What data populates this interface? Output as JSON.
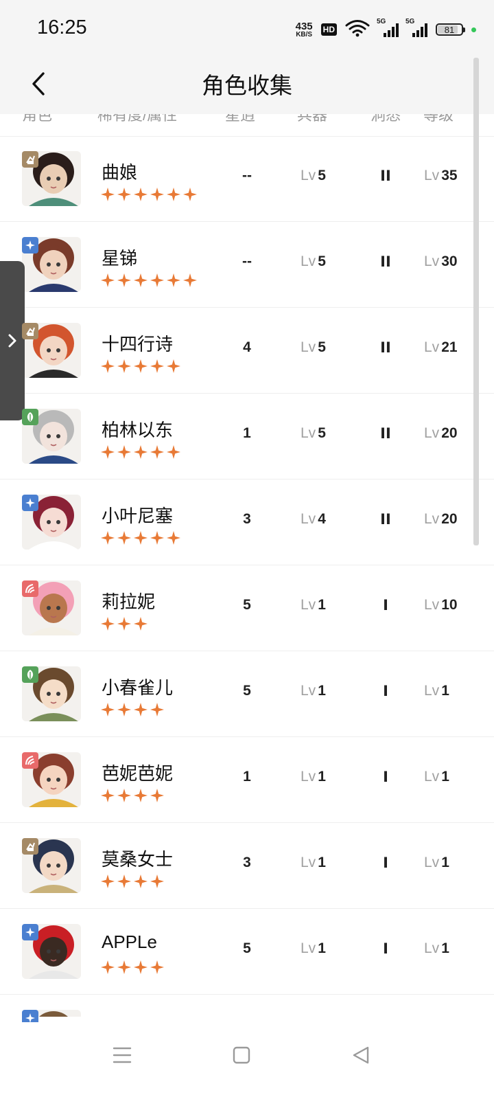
{
  "status_bar": {
    "time": "16:25",
    "net_speed_value": "435",
    "net_speed_unit": "KB/S",
    "hd_badge": "HD",
    "signal_1_label": "5G",
    "signal_2_label": "5G",
    "battery": "81",
    "icons": [
      "wifi-icon",
      "signal-icon",
      "battery-icon"
    ]
  },
  "header": {
    "title": "角色收集",
    "back_icon": "chevron-left-icon"
  },
  "columns": {
    "role": "角色",
    "rarity_attr": "稀有度/属性",
    "stars": "星逍",
    "weapon": "兵器",
    "mind": "洞悉",
    "level": "等级"
  },
  "level_prefix": "Lv",
  "element_colors": {
    "beast": "#a58a66",
    "star": "#4a7fd0",
    "plant": "#55a25a",
    "intellect": "#e86a6a"
  },
  "star_color": "#e87a36",
  "characters": [
    {
      "name": "曲娘",
      "rarity": 6,
      "element": "beast",
      "stars_val": "--",
      "weapon": "5",
      "mind": "II",
      "level": "35"
    },
    {
      "name": "星锑",
      "rarity": 6,
      "element": "star",
      "stars_val": "--",
      "weapon": "5",
      "mind": "II",
      "level": "30"
    },
    {
      "name": "十四行诗",
      "rarity": 5,
      "element": "beast",
      "stars_val": "4",
      "weapon": "5",
      "mind": "II",
      "level": "21"
    },
    {
      "name": "柏林以东",
      "rarity": 5,
      "element": "plant",
      "stars_val": "1",
      "weapon": "5",
      "mind": "II",
      "level": "20"
    },
    {
      "name": "小叶尼塞",
      "rarity": 5,
      "element": "star",
      "stars_val": "3",
      "weapon": "4",
      "mind": "II",
      "level": "20"
    },
    {
      "name": "莉拉妮",
      "rarity": 3,
      "element": "intellect",
      "stars_val": "5",
      "weapon": "1",
      "mind": "I",
      "level": "10"
    },
    {
      "name": "小春雀儿",
      "rarity": 4,
      "element": "plant",
      "stars_val": "5",
      "weapon": "1",
      "mind": "I",
      "level": "1"
    },
    {
      "name": "芭妮芭妮",
      "rarity": 4,
      "element": "intellect",
      "stars_val": "1",
      "weapon": "1",
      "mind": "I",
      "level": "1"
    },
    {
      "name": "莫桑女士",
      "rarity": 4,
      "element": "beast",
      "stars_val": "3",
      "weapon": "1",
      "mind": "I",
      "level": "1"
    },
    {
      "name": "APPLe",
      "rarity": 4,
      "element": "star",
      "stars_val": "5",
      "weapon": "1",
      "mind": "I",
      "level": "1"
    }
  ],
  "partial_next_element": "star",
  "side_tab_icon": "chevron-right-icon",
  "nav": [
    "menu-icon",
    "home-icon",
    "back-icon"
  ]
}
